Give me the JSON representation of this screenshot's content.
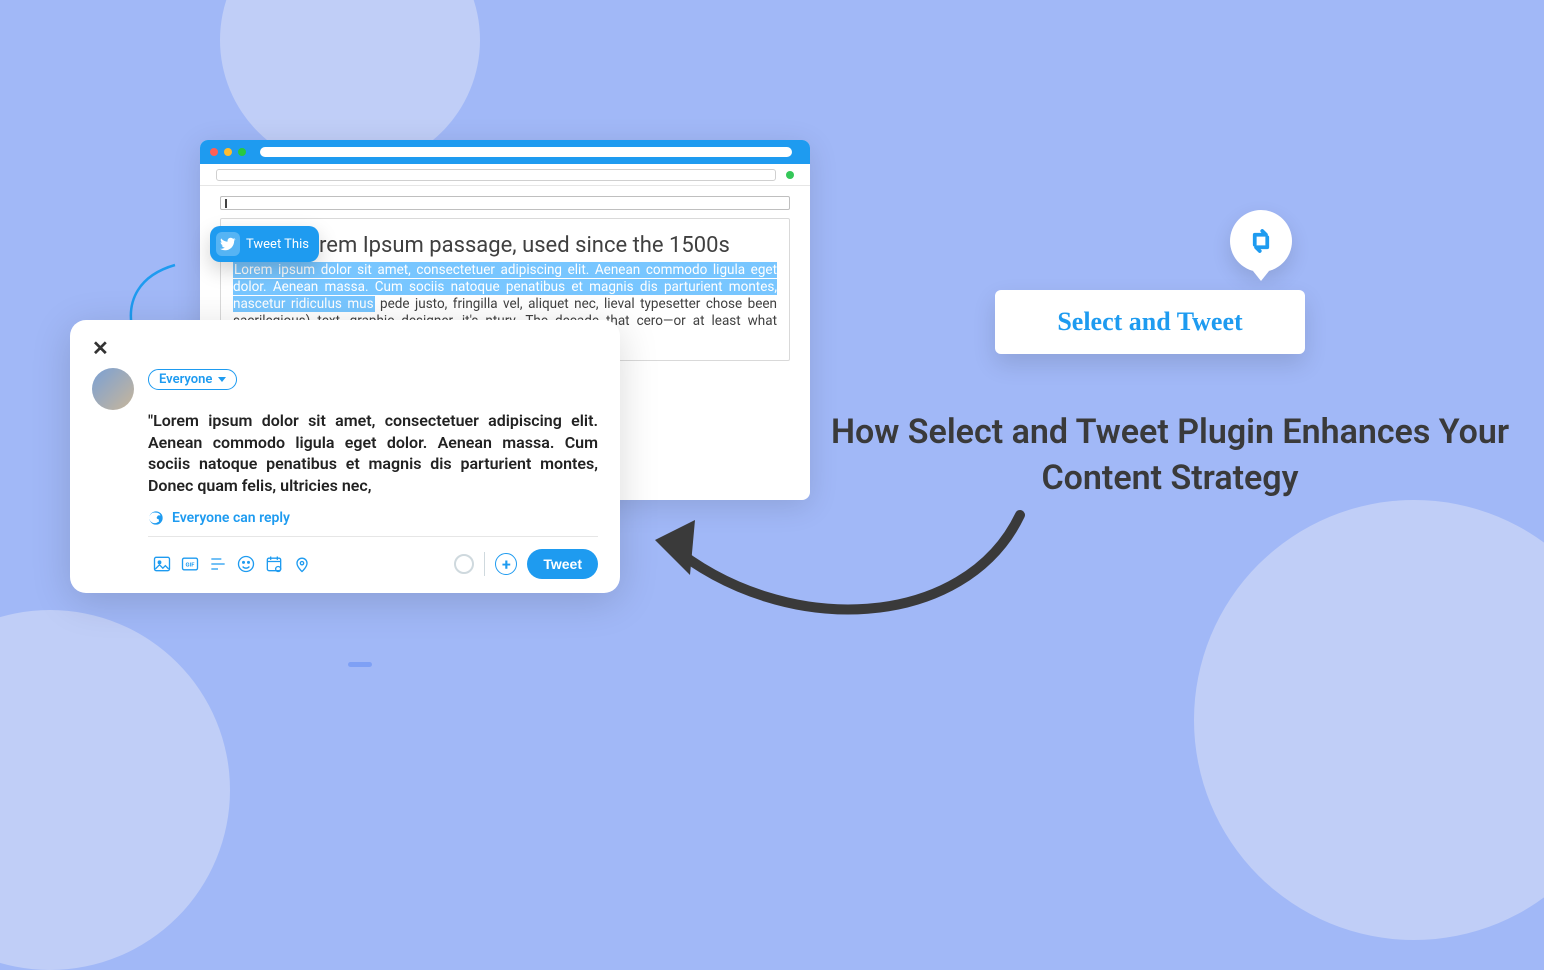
{
  "tweet_this": {
    "label": "Tweet This"
  },
  "browser": {
    "article_title": "ndard Lorem Ipsum passage, used since the 1500s",
    "highlighted": "Lorem ipsum dolor sit amet, consectetuer adipiscing elit. Aenean commodo ligula eget dolor. Aenean massa. Cum sociis natoque penatibus et magnis dis parturient montes, nascetur ridiculus mus",
    "rest": " pede justo, fringilla vel, aliquet nec, lieval typesetter chose been sacrilegious) text, graphic designer, it's ntury. The decade that cero—or at least what computerized design a"
  },
  "compose": {
    "audience": "Everyone",
    "text": "\"Lorem ipsum dolor sit amet, consectetuer adipiscing elit. Aenean commodo ligula eget dolor. Aenean massa. Cum sociis natoque penatibus et magnis dis parturient montes, Donec quam felis, ultricies nec,",
    "reply_label": "Everyone can reply",
    "tweet_button": "Tweet"
  },
  "brand": {
    "name": "Select and Tweet"
  },
  "headline": "How Select and Tweet Plugin Enhances Your Content Strategy"
}
